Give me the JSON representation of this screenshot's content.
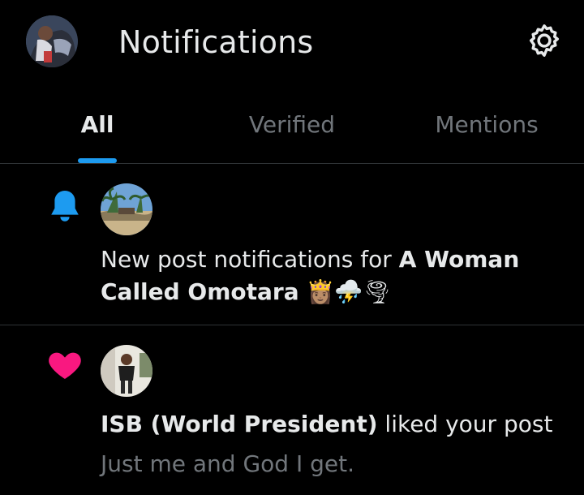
{
  "header": {
    "title": "Notifications",
    "avatar_icon": "profile-avatar",
    "settings_icon": "gear-icon"
  },
  "tabs": [
    {
      "label": "All",
      "active": true
    },
    {
      "label": "Verified",
      "active": false
    },
    {
      "label": "Mentions",
      "active": false
    }
  ],
  "colors": {
    "background": "#000000",
    "text": "#e7e9ea",
    "muted": "#71767b",
    "accent": "#1d9bf0",
    "like": "#f91880",
    "divider": "#2f3336"
  },
  "notifications": [
    {
      "type": "new-post",
      "icon": "bell-icon",
      "prefix": "New post notifications for ",
      "name_line1": "A Woman",
      "name_line2": "Called Omotara",
      "emoji": "👸🏽⛈️🌪"
    },
    {
      "type": "like",
      "icon": "heart-icon",
      "actor": "ISB (World President)",
      "action": " liked your post",
      "post_text": "Just me and God I get."
    }
  ]
}
